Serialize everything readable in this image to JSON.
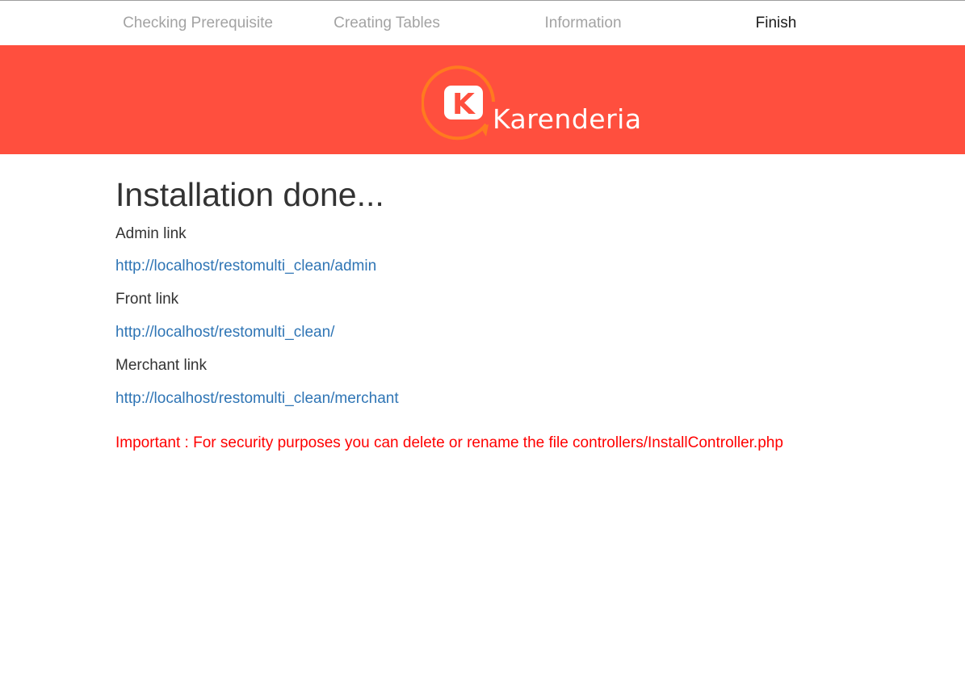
{
  "steps": [
    {
      "label": "Checking Prerequisite",
      "active": false
    },
    {
      "label": "Creating Tables",
      "active": false
    },
    {
      "label": "Information",
      "active": false
    },
    {
      "label": "Finish",
      "active": true
    }
  ],
  "banner": {
    "color": "#ff4f3e",
    "logo": {
      "icon": "karenderia-logo-icon",
      "letter": "K",
      "text": "Karenderia"
    }
  },
  "main": {
    "title": "Installation done...",
    "admin": {
      "label": "Admin link",
      "url": "http://localhost/restomulti_clean/admin"
    },
    "front": {
      "label": "Front link",
      "url": "http://localhost/restomulti_clean/"
    },
    "merchant": {
      "label": "Merchant link",
      "url": "http://localhost/restomulti_clean/merchant"
    },
    "important": "Important : For security purposes you can delete or rename the file controllers/InstallController.php"
  },
  "colors": {
    "link": "#2f75b5",
    "warning": "#ff0000",
    "step_inactive": "#a3a3a3",
    "step_active": "#1a1a1a"
  }
}
